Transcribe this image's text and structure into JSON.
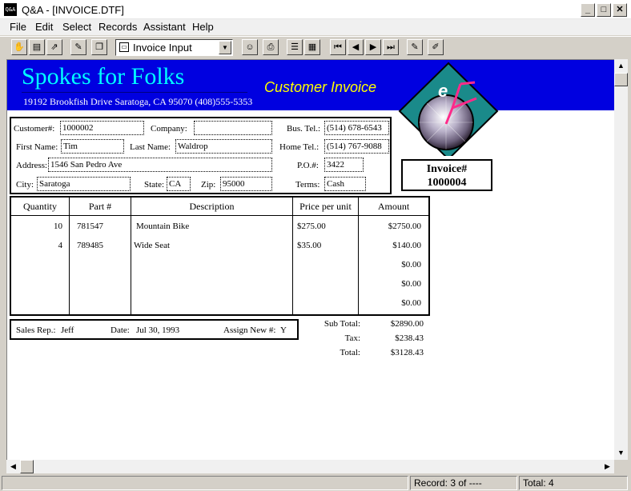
{
  "window": {
    "app_icon": "Q&A",
    "title": "Q&A - [INVOICE.DTF]",
    "minimize_glyph": "_",
    "maximize_glyph": "□",
    "close_glyph": "✕"
  },
  "menu": [
    "File",
    "Edit",
    "Select",
    "Records",
    "Assistant",
    "Help"
  ],
  "toolbar": {
    "view_select": "Invoice Input",
    "icons": [
      "hand-icon",
      "form-edit-icon",
      "form-export-icon",
      "form-check-icon",
      "form-copy-icon",
      "person-icon",
      "print-icon",
      "list-view-icon",
      "table-view-icon",
      "first-record-icon",
      "prev-record-icon",
      "next-record-icon",
      "last-record-icon",
      "form-new-icon",
      "form-delete-icon"
    ]
  },
  "invoice": {
    "company_name": "Spokes for Folks",
    "company_address": "19192 Brookfish Drive  Saratoga, CA 95070 (408)555-5353",
    "heading": "Customer Invoice",
    "logo_letter": "e",
    "customer": {
      "customer_no_label": "Customer#:",
      "customer_no": "1000002",
      "company_label": "Company:",
      "company": "",
      "bus_tel_label": "Bus. Tel.:",
      "bus_tel": "(514) 678-6543",
      "first_name_label": "First Name:",
      "first_name": "Tim",
      "last_name_label": "Last Name:",
      "last_name": "Waldrop",
      "home_tel_label": "Home Tel.:",
      "home_tel": "(514) 767-9088",
      "address_label": "Address:",
      "address": "1546 San Pedro Ave",
      "po_label": "P.O.#:",
      "po": "3422",
      "city_label": "City:",
      "city": "Saratoga",
      "state_label": "State:",
      "state": "CA",
      "zip_label": "Zip:",
      "zip": "95000",
      "terms_label": "Terms:",
      "terms": "Cash"
    },
    "invoice_no_label": "Invoice#",
    "invoice_no": "1000004",
    "table_headers": [
      "Quantity",
      "Part #",
      "Description",
      "Price per unit",
      "Amount"
    ],
    "rows": [
      {
        "qty": "10",
        "part": "781547",
        "desc": "Mountain Bike",
        "price": "$275.00",
        "amount": "$2750.00"
      },
      {
        "qty": "4",
        "part": "789485",
        "desc": "Wide Seat",
        "price": "$35.00",
        "amount": "$140.00"
      },
      {
        "qty": "",
        "part": "",
        "desc": "",
        "price": "",
        "amount": "$0.00"
      },
      {
        "qty": "",
        "part": "",
        "desc": "",
        "price": "",
        "amount": "$0.00"
      },
      {
        "qty": "",
        "part": "",
        "desc": "",
        "price": "",
        "amount": "$0.00"
      }
    ],
    "footer": {
      "sales_rep_label": "Sales Rep.:",
      "sales_rep": "Jeff",
      "date_label": "Date:",
      "date": "Jul 30, 1993",
      "assign_label": "Assign New #:",
      "assign": "Y"
    },
    "totals": {
      "subtotal_label": "Sub Total:",
      "subtotal": "$2890.00",
      "tax_label": "Tax:",
      "tax": "$238.43",
      "total_label": "Total:",
      "total": "$3128.43"
    }
  },
  "status": {
    "record": "Record: 3 of ----",
    "total": "Total: 4"
  }
}
